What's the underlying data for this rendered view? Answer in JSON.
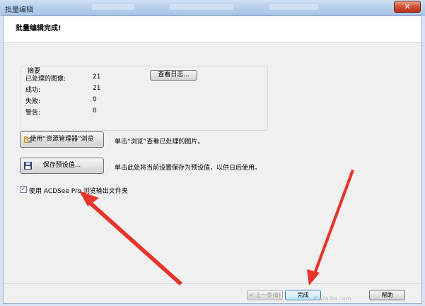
{
  "window": {
    "title": "批量编辑",
    "close_glyph": "✕"
  },
  "header": {
    "title": "批量编辑完成!"
  },
  "summary": {
    "title": "摘要",
    "rows": [
      {
        "label": "已处理的图像:",
        "value": "21"
      },
      {
        "label": "成功:",
        "value": "21"
      },
      {
        "label": "失败:",
        "value": "0"
      },
      {
        "label": "警告:",
        "value": "0"
      }
    ],
    "view_log_label": "查看日志..."
  },
  "actions": {
    "explorer_button_label": "使用“资源管理器”浏览",
    "explorer_desc": "单击“浏览”查看已处理的图片。",
    "save_preset_label": "保存预设值...",
    "save_preset_desc": "单击此处将当前设置保存为预设值，以供日后使用。"
  },
  "option": {
    "checked": true,
    "label": "使用 ACDSee Pro 浏览输出文件夹"
  },
  "footer": {
    "back_label": "< 上一步(B)",
    "finish_label": "完成",
    "help_label": "帮助"
  },
  "watermark": "Xiazaiba.com",
  "colors": {
    "annotation_arrow": "#e8332a",
    "accent": "#3c7fb1"
  },
  "icons": {
    "explorer": "folder-magnify-icon",
    "save": "floppy-disk-icon"
  }
}
